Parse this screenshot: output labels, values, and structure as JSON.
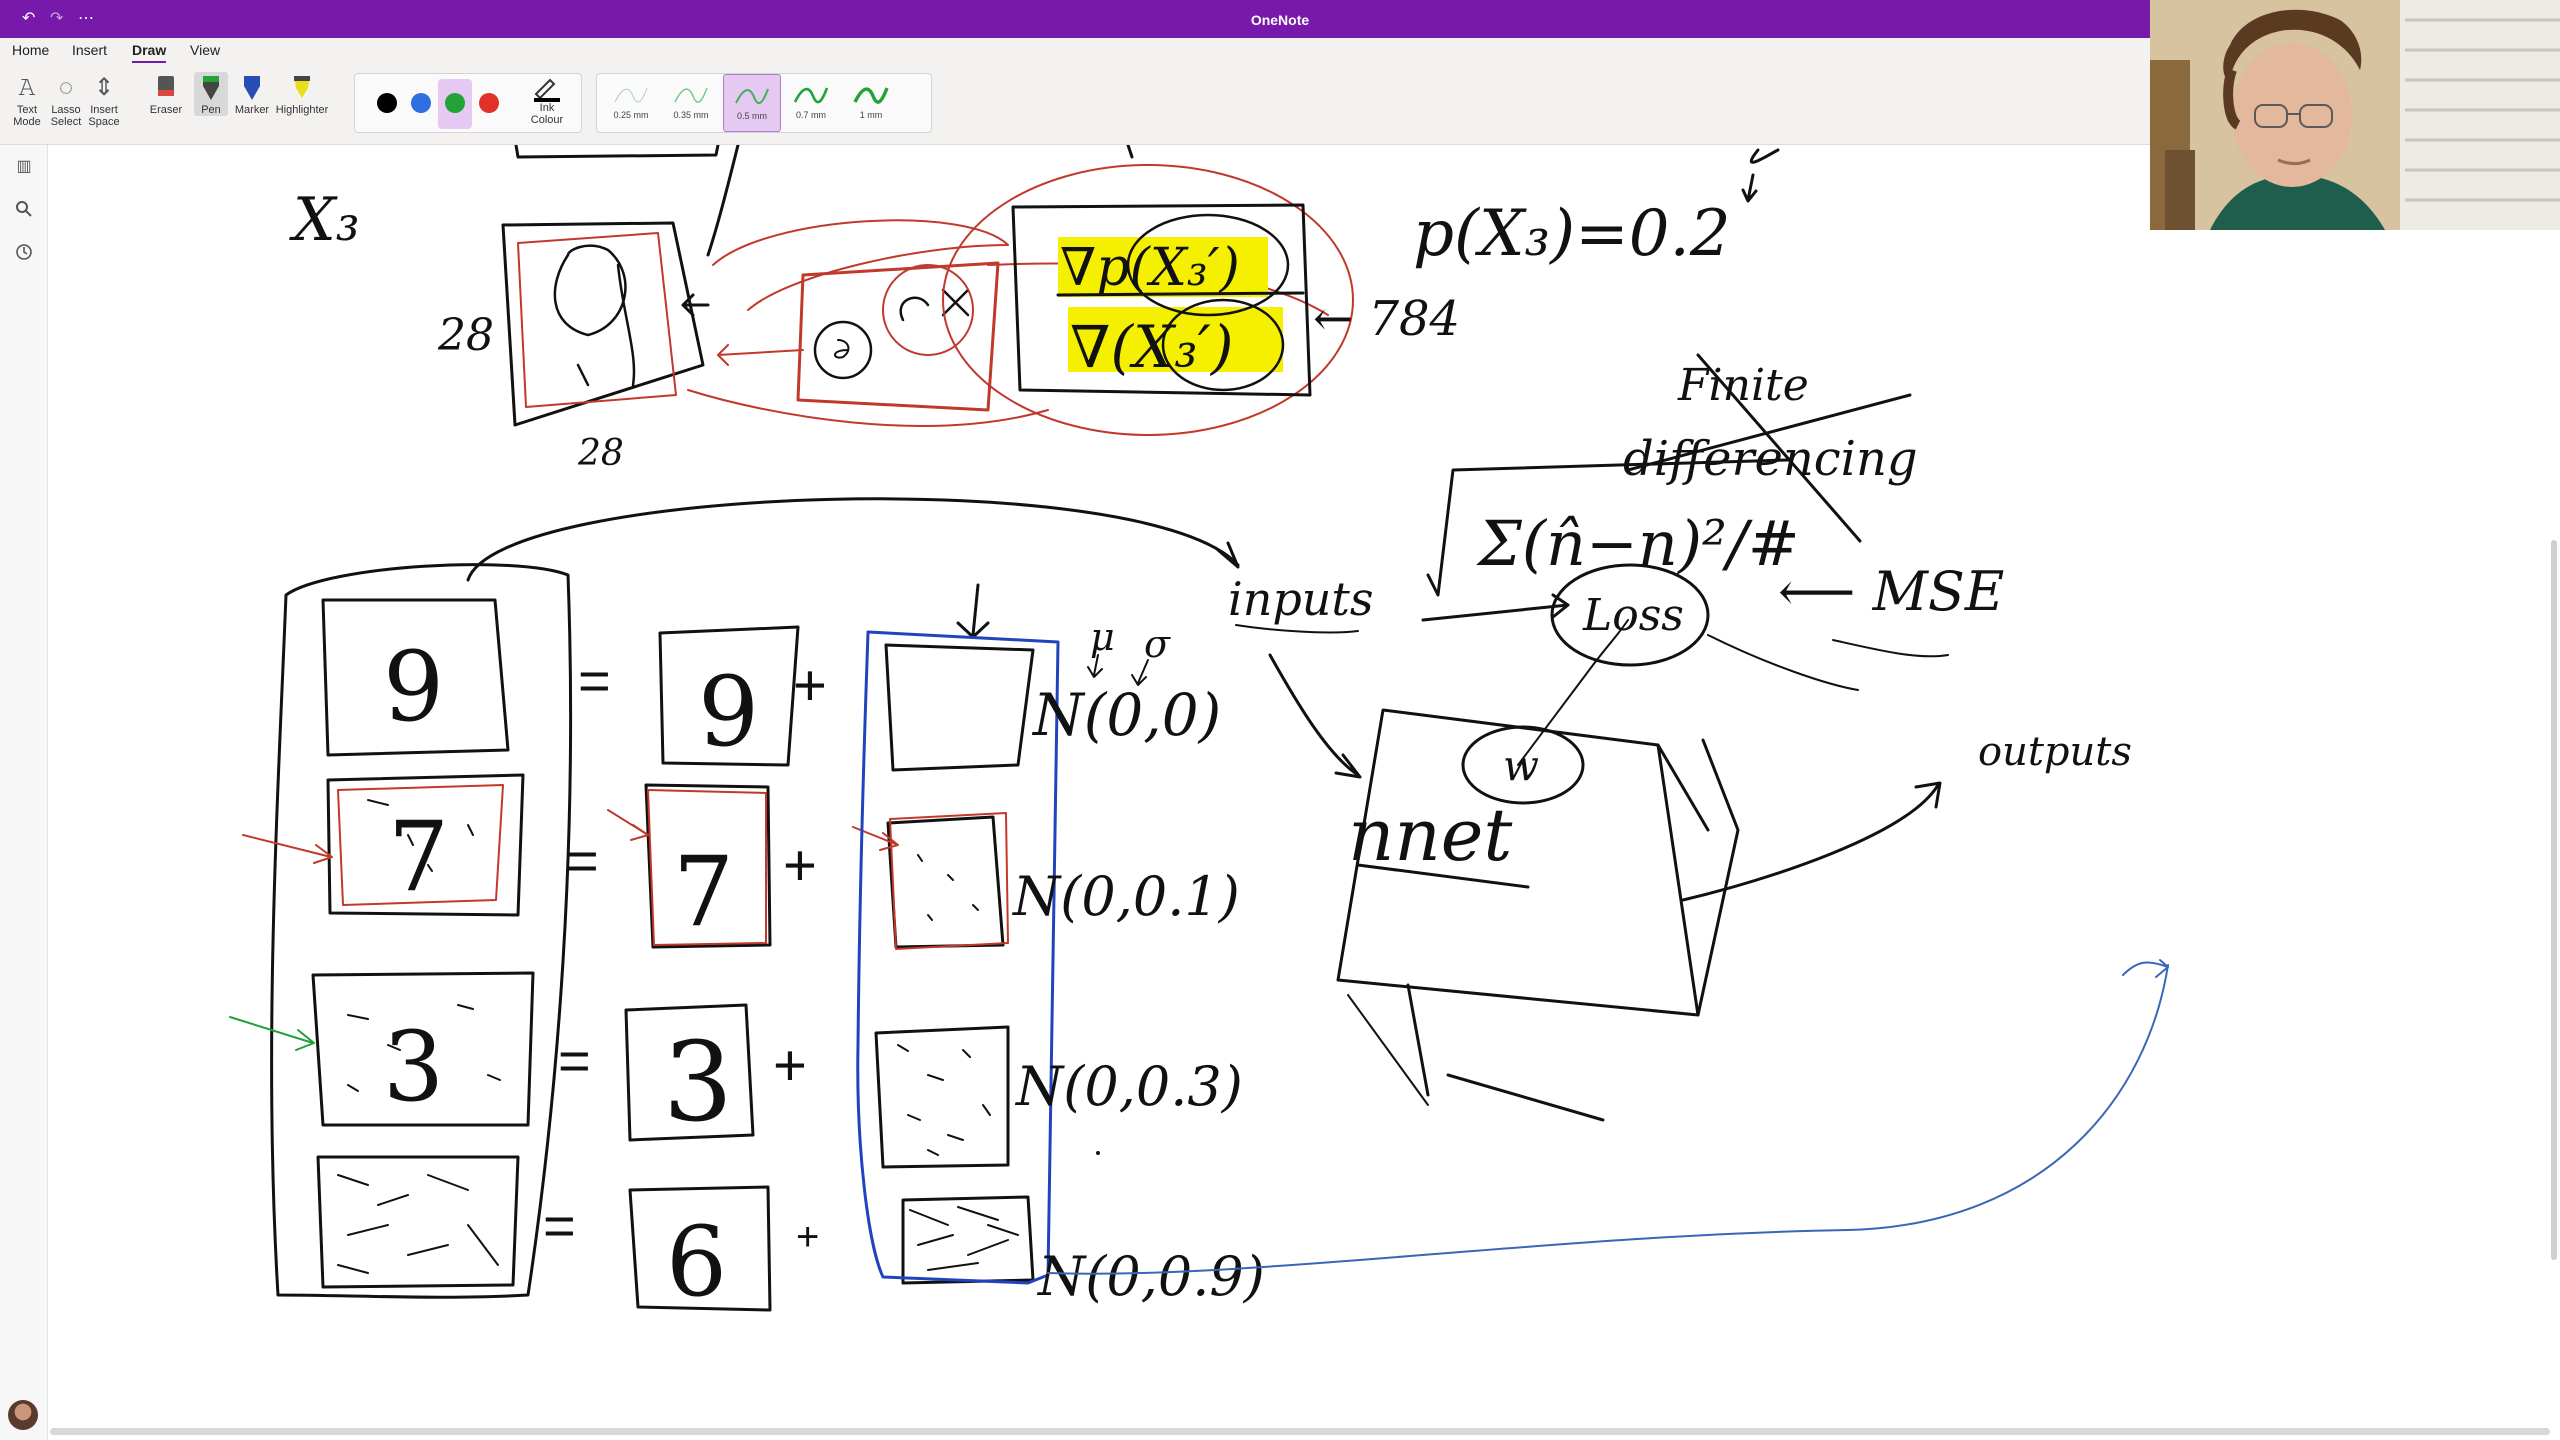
{
  "titlebar": {
    "app_title": "OneNote",
    "undo_icon": "undo-icon",
    "redo_icon": "redo-icon",
    "more_icon": "more-icon"
  },
  "menu": {
    "tabs": [
      "Home",
      "Insert",
      "Draw",
      "View"
    ],
    "active": "Draw"
  },
  "ribbon": {
    "tools": [
      {
        "label1": "Text",
        "label2": "Mode",
        "icon": "text-mode-icon"
      },
      {
        "label1": "Lasso",
        "label2": "Select",
        "icon": "lasso-select-icon"
      },
      {
        "label1": "Insert",
        "label2": "Space",
        "icon": "insert-space-icon"
      }
    ],
    "pens": [
      {
        "label": "Eraser",
        "icon": "eraser-icon"
      },
      {
        "label": "Pen",
        "icon": "pen-icon"
      },
      {
        "label": "Marker",
        "icon": "marker-icon"
      },
      {
        "label": "Highlighter",
        "icon": "highlighter-icon"
      }
    ],
    "colors": [
      "#000000",
      "#2f6fe0",
      "#21a336",
      "#e0312b"
    ],
    "selected_color": "#21a336",
    "ink_colour_label1": "Ink",
    "ink_colour_label2": "Colour",
    "thickness": [
      "0.25 mm",
      "0.35 mm",
      "0.5 mm",
      "0.7 mm",
      "1 mm"
    ],
    "selected_thickness": "0.5 mm",
    "thickness_color": "#21a336"
  },
  "sidebar": {
    "icons": [
      "library-icon",
      "search-icon",
      "recent-icon"
    ]
  },
  "ink": {
    "colors": {
      "black": "#111111",
      "red": "#c0392b",
      "blue": "#2244bb",
      "green": "#22a03c",
      "highlight": "#f5f000",
      "thin_blue": "#3a66b5"
    },
    "labels": {
      "x3": "X₃",
      "n28a": "28",
      "n28b": "28",
      "n784": "← 784",
      "prob": "p(X₃)=0.2",
      "grad1": "∇p(X₃′)",
      "grad2": "∇(X₃′)",
      "finite": "Finite",
      "differencing": "differencing",
      "formula": "Σ(n̂−n)²/#",
      "loss": "Loss",
      "mse": "⟵ MSE",
      "inputs": "inputs",
      "outputs": "outputs",
      "nnet": "nnet",
      "w": "w",
      "mu": "μ",
      "sigma": "σ",
      "n00": "N(0,0)",
      "n01": "N(0,0.1)",
      "n03": "N(0,0.3)",
      "n09": "N(0,0.9)",
      "d9a": "9",
      "d9b": "9",
      "d7a": "7",
      "d7b": "7",
      "d3a": "3",
      "d3b": "3",
      "d6": "6",
      "eq": "=",
      "plus": "+"
    }
  }
}
